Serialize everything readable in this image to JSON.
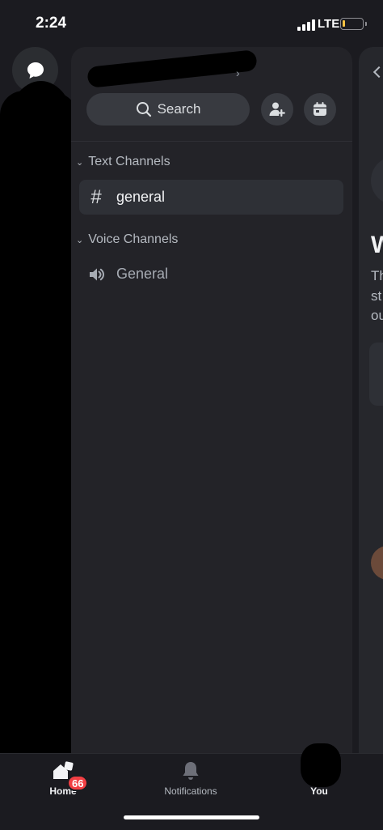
{
  "status_bar": {
    "time": "2:24",
    "network": "LTE",
    "battery_level": 0.12,
    "battery_color": "#f5c242"
  },
  "server": {
    "name": ""
  },
  "toolbar": {
    "search_label": "Search",
    "invite_icon": "add-member-icon",
    "events_icon": "calendar-icon"
  },
  "categories": [
    {
      "label": "Text Channels",
      "channels": [
        {
          "name": "general",
          "type": "text",
          "active": true
        }
      ]
    },
    {
      "label": "Voice Channels",
      "channels": [
        {
          "name": "General",
          "type": "voice",
          "active": false
        }
      ]
    }
  ],
  "peek": {
    "heading": "W",
    "line1": "Th",
    "line2": "st",
    "line3": "ou"
  },
  "bottom_nav": {
    "items": [
      {
        "label": "Home",
        "active": true,
        "badge": "66"
      },
      {
        "label": "Notifications",
        "active": false
      },
      {
        "label": "You",
        "active": false
      }
    ]
  },
  "colors": {
    "background": "#1b1b20",
    "panel": "#232328",
    "accent_badge": "#f23f43"
  }
}
